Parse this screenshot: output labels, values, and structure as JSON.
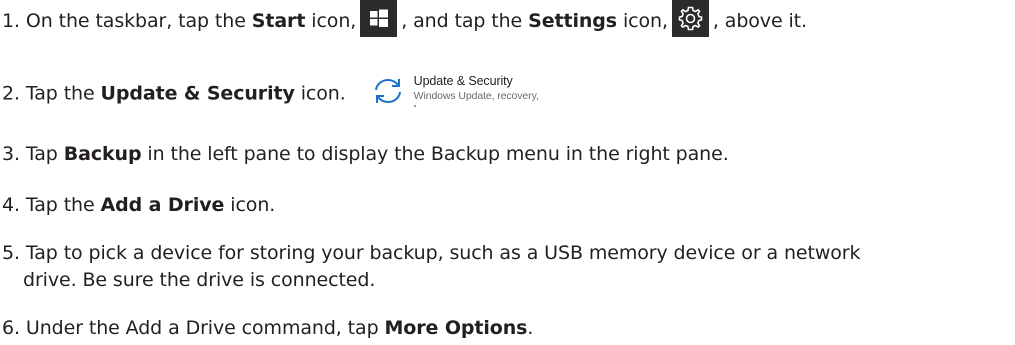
{
  "steps": [
    {
      "number": "1.",
      "pre": "On the taskbar, tap the",
      "bold1": "Start",
      "mid1": "icon,",
      "mid2": ", and tap the",
      "bold2": "Settings",
      "mid3": "icon,",
      "post": ", above it.",
      "icons": [
        "windows-start-icon",
        "gear-icon"
      ]
    },
    {
      "number": "2.",
      "pre": "Tap the",
      "bold": "Update & Security",
      "post": "icon.",
      "tile": {
        "icon": "sync-icon",
        "title": "Update & Security",
        "description": "Windows Update, recovery,"
      }
    },
    {
      "number": "3.",
      "pre": "Tap",
      "bold": "Backup",
      "post": "in the left pane to display the Backup menu in the right pane."
    },
    {
      "number": "4.",
      "pre": "Tap the",
      "bold": "Add a Drive",
      "post": "icon."
    },
    {
      "number": "5.",
      "line1": "Tap to pick a device for storing your backup, such as a USB memory device or a network",
      "line2": "drive. Be sure the drive is connected."
    },
    {
      "number": "6.",
      "pre": "Under the Add a Drive command, tap",
      "bold": "More Options",
      "post": "."
    }
  ],
  "colors": {
    "text": "#231f20",
    "icon_bg": "#2b2b2b",
    "sync_icon": "#1a73c8"
  }
}
